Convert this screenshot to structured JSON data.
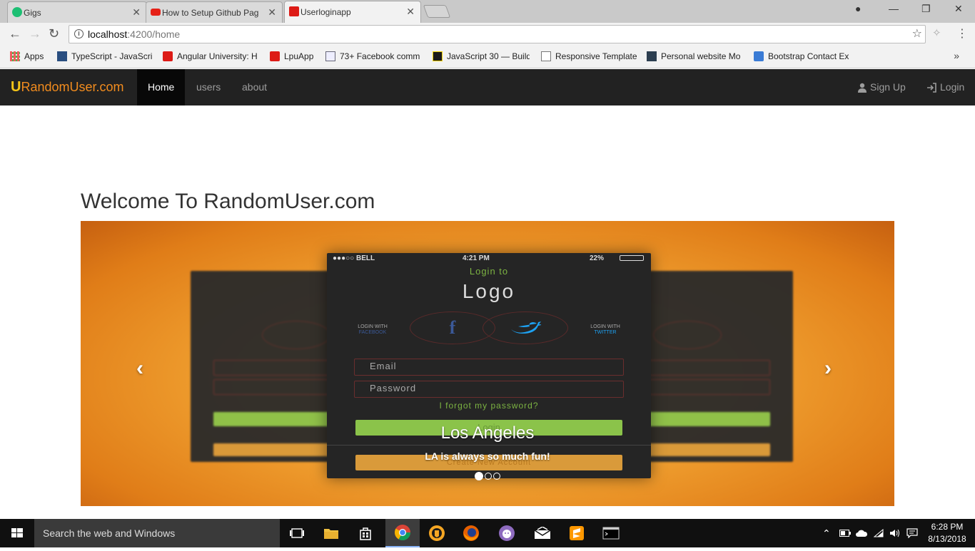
{
  "browser": {
    "tabs": [
      {
        "title": "Gigs",
        "favicon_color": "#1dbf73"
      },
      {
        "title": "How to Setup Github Pag",
        "favicon_color": "#e62117"
      },
      {
        "title": "Userloginapp",
        "favicon_color": "#dd1b16"
      }
    ],
    "url_host": "localhost",
    "url_path": ":4200/home",
    "bookmarks": [
      {
        "label": "Apps"
      },
      {
        "label": "TypeScript - JavaScrip"
      },
      {
        "label": "Angular University: H"
      },
      {
        "label": "LpuApp"
      },
      {
        "label": "73+ Facebook comm"
      },
      {
        "label": "JavaScript 30 — Build"
      },
      {
        "label": "Responsive Template"
      },
      {
        "label": "Personal website Mo"
      },
      {
        "label": "Bootstrap Contact Ex"
      }
    ],
    "bookmarks_overflow": "»"
  },
  "navbar": {
    "brand_letter": "U",
    "brand_text": "RandomUser.com",
    "items": [
      {
        "label": "Home",
        "active": true
      },
      {
        "label": "users",
        "active": false
      },
      {
        "label": "about",
        "active": false
      }
    ],
    "signup_label": "Sign Up",
    "login_label": "Login"
  },
  "page": {
    "heading": "Welcome To RandomUser.com"
  },
  "carousel": {
    "phone": {
      "carrier": "●●●○○ BELL",
      "time": "4:21 PM",
      "battery": "22%",
      "login_to": "Login to",
      "logo": "Logo",
      "login_with_left": "LOGIN WITH",
      "login_with_left_sub": "FACEBOOK",
      "login_with_right": "LOGIN WITH",
      "login_with_right_sub": "TWITTER",
      "email_placeholder": "Email",
      "password_placeholder": "Password",
      "forgot": "I forgot my password?",
      "login_button": "Login",
      "create_button": "Create New Account"
    },
    "caption_title": "Los Angeles",
    "caption_text": "LA is always so much fun!",
    "slide_count": 3,
    "active_slide": 0
  },
  "taskbar": {
    "search_placeholder": "Search the web and Windows",
    "time": "6:28 PM",
    "date": "8/13/2018"
  }
}
